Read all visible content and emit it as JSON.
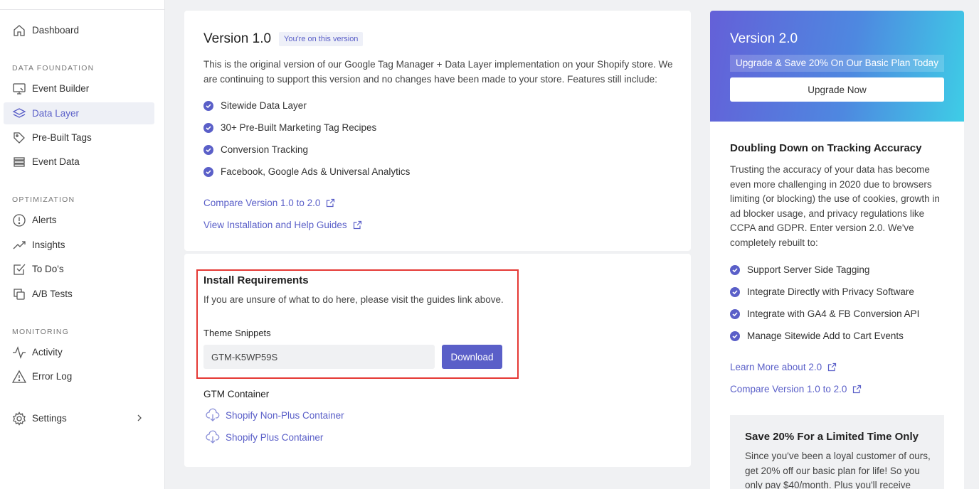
{
  "sidebar": {
    "dashboard": "Dashboard",
    "sections": {
      "data_foundation": "DATA FOUNDATION",
      "optimization": "OPTIMIZATION",
      "monitoring": "MONITORING"
    },
    "items": {
      "event_builder": "Event Builder",
      "data_layer": "Data Layer",
      "pre_built_tags": "Pre-Built Tags",
      "event_data": "Event Data",
      "alerts": "Alerts",
      "insights": "Insights",
      "todos": "To Do's",
      "ab_tests": "A/B Tests",
      "activity": "Activity",
      "error_log": "Error Log",
      "settings": "Settings"
    },
    "active_item": "Data Layer"
  },
  "v1": {
    "title": "Version 1.0",
    "badge": "You're on this version",
    "description": "This is the original version of our Google Tag Manager + Data Layer implementation on your Shopify store. We are continuing to support this version and no changes have been made to your store. Features still include:",
    "features": [
      "Sitewide Data Layer",
      "30+ Pre-Built Marketing Tag Recipes",
      "Conversion Tracking",
      "Facebook, Google Ads & Universal Analytics"
    ],
    "links": {
      "compare": "Compare Version 1.0 to 2.0",
      "guides": "View Installation and Help Guides"
    }
  },
  "install": {
    "title": "Install Requirements",
    "description": "If you are unsure of what to do here, please visit the guides link above.",
    "snippets_label": "Theme Snippets",
    "snippet_value": "GTM-K5WP59S",
    "download_label": "Download",
    "gtm_label": "GTM Container",
    "containers": [
      "Shopify Non-Plus Container",
      "Shopify Plus Container"
    ]
  },
  "v2": {
    "title": "Version 2.0",
    "promo": "Upgrade & Save 20% On Our Basic Plan Today",
    "upgrade_label": "Upgrade Now",
    "heading": "Doubling Down on Tracking Accuracy",
    "description": "Trusting the accuracy of your data has become even more challenging in 2020 due to browsers limiting (or blocking) the use of cookies, growth in ad blocker usage, and privacy regulations like CCPA and GDPR. Enter version 2.0. We've completely rebuilt to:",
    "features": [
      "Support Server Side Tagging",
      "Integrate Directly with Privacy Software",
      "Integrate with GA4 & FB Conversion API",
      "Manage Sitewide Add to Cart Events"
    ],
    "links": {
      "learn_more": "Learn More about 2.0",
      "compare": "Compare Version 1.0 to 2.0"
    },
    "save_box": {
      "title": "Save 20% For a Limited Time Only",
      "text": "Since you've been a loyal customer of ours, get 20% off our basic plan for life! So you only pay $40/month. Plus you'll receive these"
    }
  },
  "colors": {
    "accent": "#5a5fc8",
    "highlight_border": "#e53935",
    "gradient_start": "#6460d8",
    "gradient_end": "#3ecde6"
  }
}
